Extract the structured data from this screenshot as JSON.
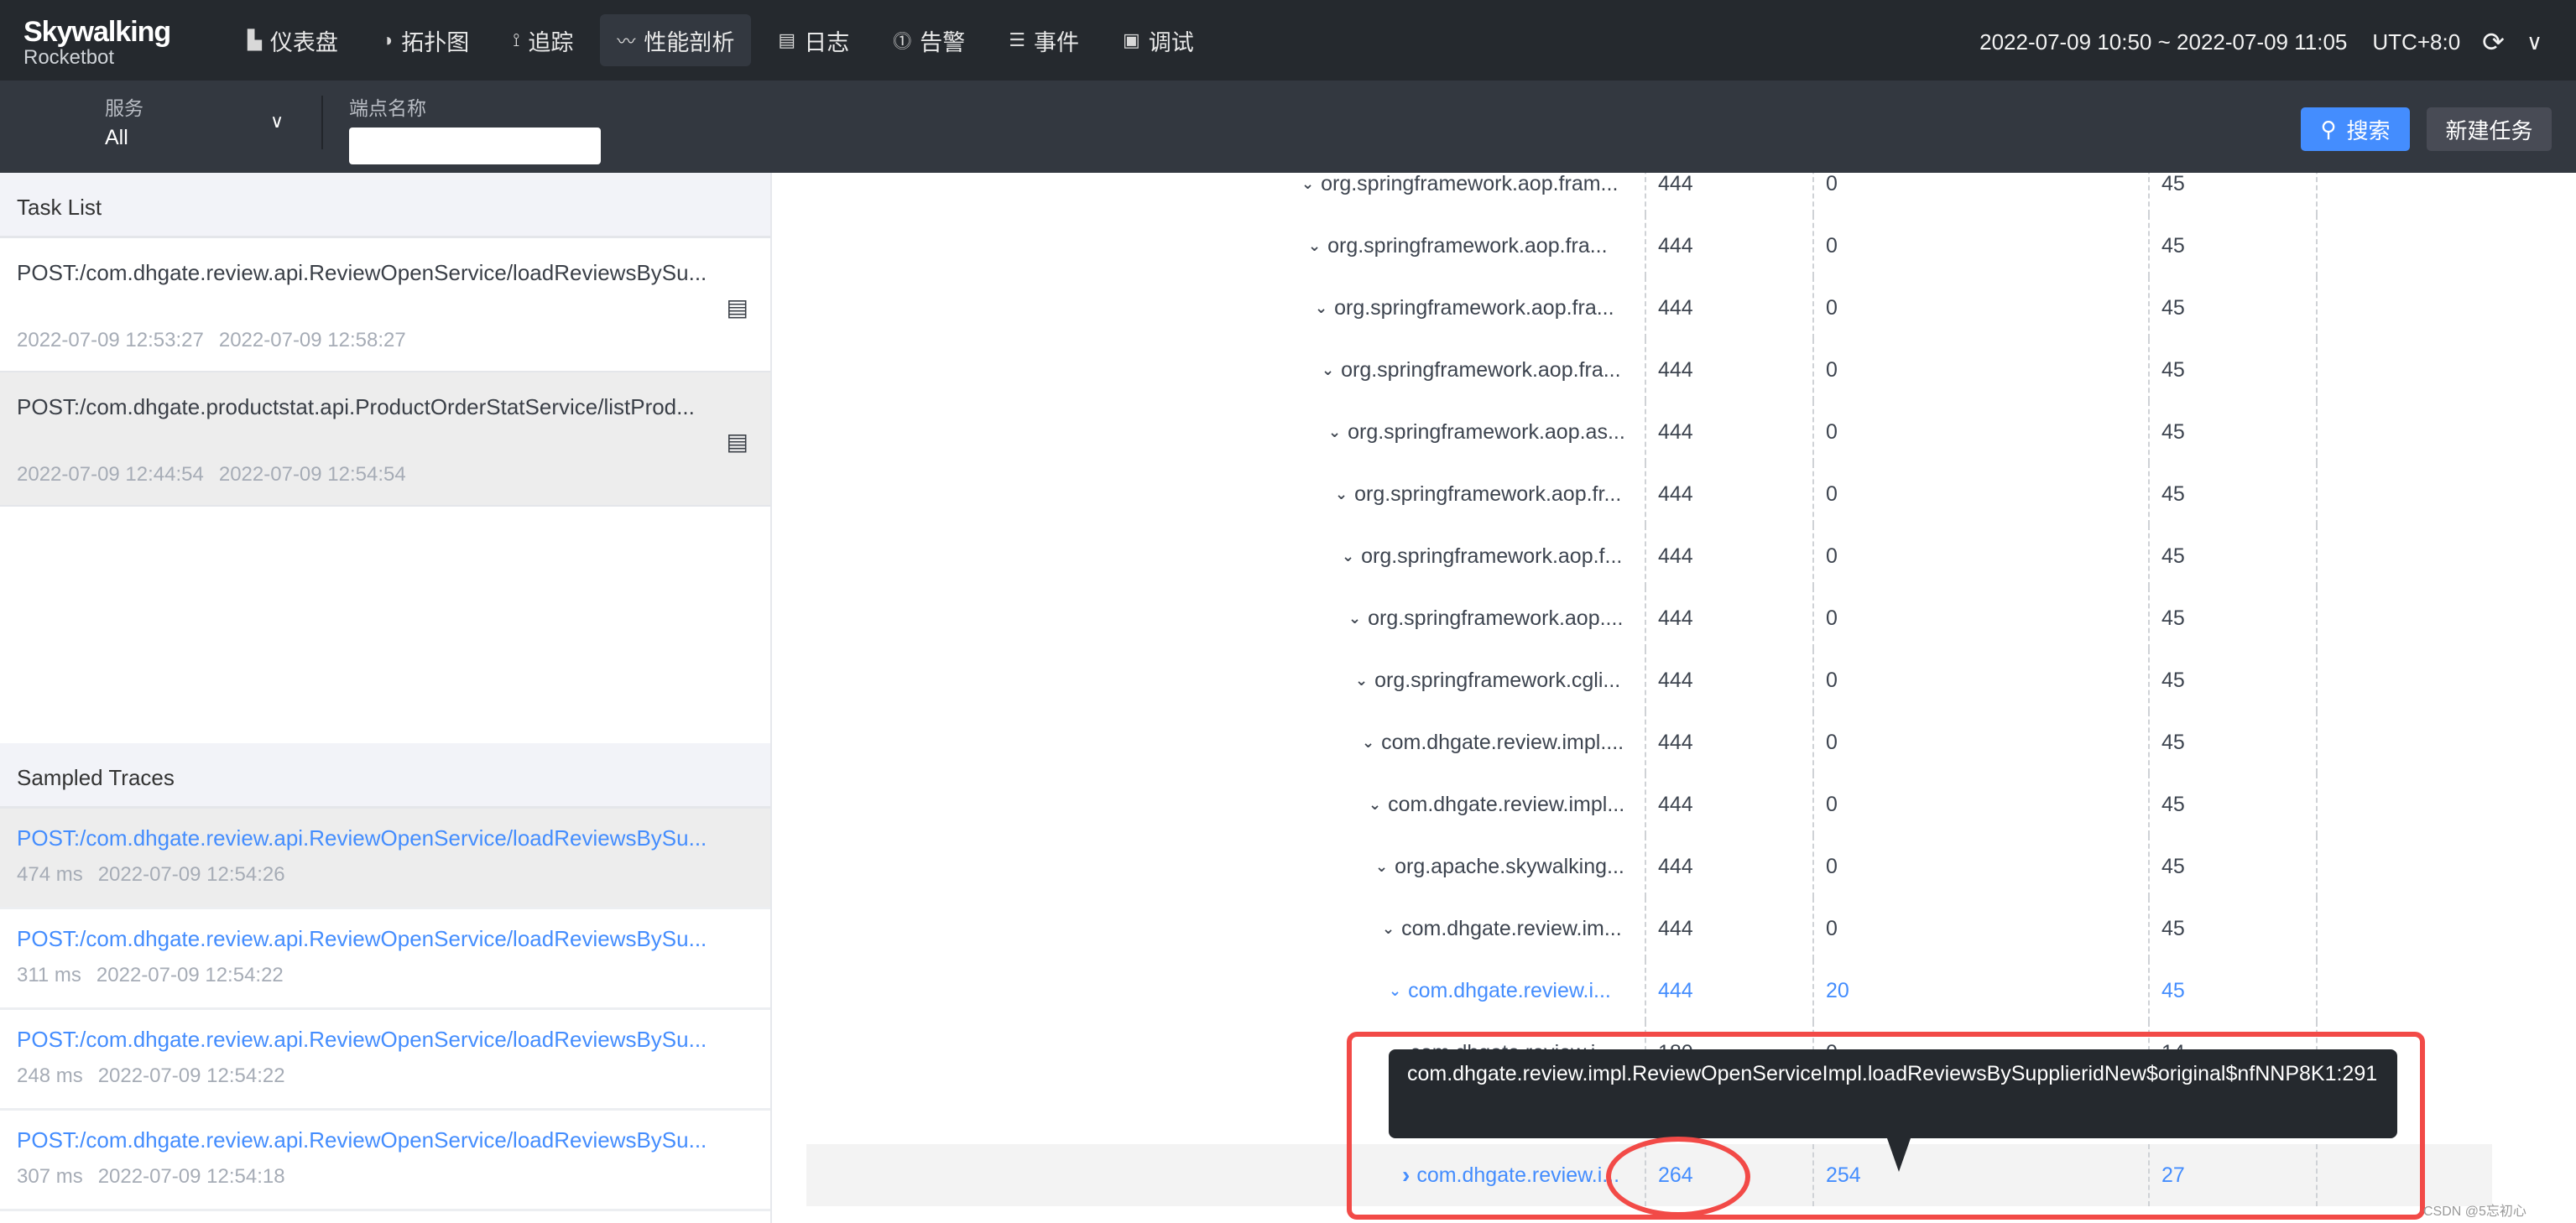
{
  "brand": {
    "name": "Skywalking",
    "sub": "Rocketbot"
  },
  "nav": [
    {
      "label": "仪表盘",
      "icon": "chart-icon",
      "glyph": "▙"
    },
    {
      "label": "拓扑图",
      "icon": "topology-icon",
      "glyph": "◑"
    },
    {
      "label": "追踪",
      "icon": "trace-icon",
      "glyph": "⟟"
    },
    {
      "label": "性能剖析",
      "icon": "profile-icon",
      "glyph": "〰",
      "active": true
    },
    {
      "label": "日志",
      "icon": "log-icon",
      "glyph": "▤"
    },
    {
      "label": "告警",
      "icon": "alarm-icon",
      "glyph": "⓵"
    },
    {
      "label": "事件",
      "icon": "event-icon",
      "glyph": "☰"
    },
    {
      "label": "调试",
      "icon": "debug-icon",
      "glyph": "▣"
    }
  ],
  "time_range": "2022-07-09 10:50 ~ 2022-07-09 11:05",
  "timezone": "UTC+8:0",
  "toolbar": {
    "service_label": "服务",
    "service_value": "All",
    "endpoint_label": "端点名称",
    "endpoint_value": "",
    "search_label": "搜索",
    "new_task_label": "新建任务"
  },
  "task_list": {
    "title": "Task List",
    "items": [
      {
        "name": "POST:/com.dhgate.review.api.ReviewOpenService/loadReviewsBySu...",
        "start": "2022-07-09 12:53:27",
        "end": "2022-07-09 12:58:27"
      },
      {
        "name": "POST:/com.dhgate.productstat.api.ProductOrderStatService/listProd...",
        "start": "2022-07-09 12:44:54",
        "end": "2022-07-09 12:54:54",
        "selected": true
      }
    ]
  },
  "sampled_traces": {
    "title": "Sampled Traces",
    "items": [
      {
        "name": "POST:/com.dhgate.review.api.ReviewOpenService/loadReviewsBySu...",
        "duration": "474 ms",
        "time": "2022-07-09 12:54:26",
        "selected": true
      },
      {
        "name": "POST:/com.dhgate.review.api.ReviewOpenService/loadReviewsBySu...",
        "duration": "311 ms",
        "time": "2022-07-09 12:54:22"
      },
      {
        "name": "POST:/com.dhgate.review.api.ReviewOpenService/loadReviewsBySu...",
        "duration": "248 ms",
        "time": "2022-07-09 12:54:22"
      },
      {
        "name": "POST:/com.dhgate.review.api.ReviewOpenService/loadReviewsBySu...",
        "duration": "307 ms",
        "time": "2022-07-09 12:54:18"
      }
    ]
  },
  "tree_rows": [
    {
      "name": "org.springframework.aop.fram...",
      "v1": "444",
      "v2": "0",
      "v3": "45",
      "expanded": true
    },
    {
      "name": "org.springframework.aop.fra...",
      "v1": "444",
      "v2": "0",
      "v3": "45",
      "expanded": true
    },
    {
      "name": "org.springframework.aop.fra...",
      "v1": "444",
      "v2": "0",
      "v3": "45",
      "expanded": true
    },
    {
      "name": "org.springframework.aop.fra...",
      "v1": "444",
      "v2": "0",
      "v3": "45",
      "expanded": true
    },
    {
      "name": "org.springframework.aop.as...",
      "v1": "444",
      "v2": "0",
      "v3": "45",
      "expanded": true
    },
    {
      "name": "org.springframework.aop.fr...",
      "v1": "444",
      "v2": "0",
      "v3": "45",
      "expanded": true
    },
    {
      "name": "org.springframework.aop.f...",
      "v1": "444",
      "v2": "0",
      "v3": "45",
      "expanded": true
    },
    {
      "name": "org.springframework.aop....",
      "v1": "444",
      "v2": "0",
      "v3": "45",
      "expanded": true
    },
    {
      "name": "org.springframework.cgli...",
      "v1": "444",
      "v2": "0",
      "v3": "45",
      "expanded": true
    },
    {
      "name": "com.dhgate.review.impl....",
      "v1": "444",
      "v2": "0",
      "v3": "45",
      "expanded": true
    },
    {
      "name": "com.dhgate.review.impl...",
      "v1": "444",
      "v2": "0",
      "v3": "45",
      "expanded": true
    },
    {
      "name": "org.apache.skywalking...",
      "v1": "444",
      "v2": "0",
      "v3": "45",
      "expanded": true
    },
    {
      "name": "com.dhgate.review.im...",
      "v1": "444",
      "v2": "0",
      "v3": "45",
      "expanded": true
    },
    {
      "name": "com.dhgate.review.i...",
      "v1": "444",
      "v2": "20",
      "v3": "45",
      "expanded": true,
      "highlight": true
    },
    {
      "name": "com.dhgate.review.i...",
      "v1": "180",
      "v2": "0",
      "v3": "14",
      "expanded": false
    },
    null,
    {
      "name": "com.dhgate.review.i...",
      "v1": "264",
      "v2": "254",
      "v3": "27",
      "expanded": false,
      "highlight": true,
      "selected": true
    }
  ],
  "tooltip": "com.dhgate.review.impl.ReviewOpenServiceImpl.loadReviewsBySupplieridNew$original$nfNNP8K1:291",
  "annotation_color": "#f24a47",
  "accent": "#448dfe",
  "watermark": "CSDN @5忘初心"
}
